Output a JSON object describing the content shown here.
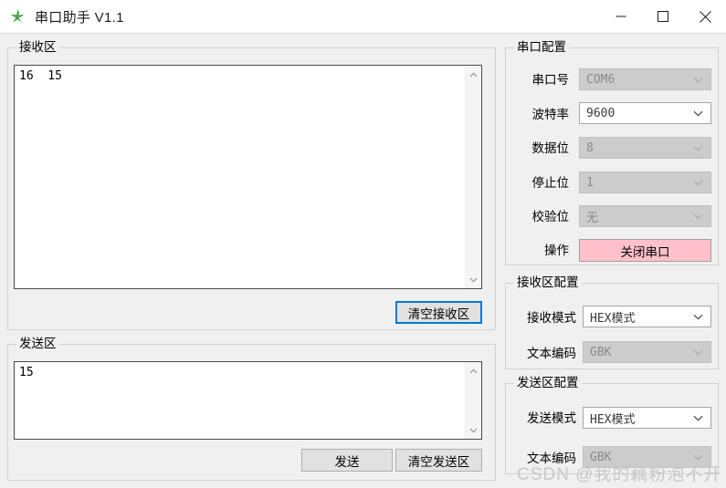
{
  "window": {
    "title": "串口助手 V1.1",
    "icon": "app-star-icon",
    "minimize_label": "—",
    "maximize_label": "□",
    "close_label": "✕"
  },
  "receive_area": {
    "legend": "接收区",
    "content": "16  15",
    "clear_button": "清空接收区"
  },
  "send_area": {
    "legend": "发送区",
    "content": "15",
    "send_button": "发送",
    "clear_button": "清空发送区"
  },
  "serial_config": {
    "legend": "串口配置",
    "rows": [
      {
        "label": "串口号",
        "value": "COM6",
        "enabled": false
      },
      {
        "label": "波特率",
        "value": "9600",
        "enabled": true
      },
      {
        "label": "数据位",
        "value": "8",
        "enabled": false
      },
      {
        "label": "停止位",
        "value": "1",
        "enabled": false
      },
      {
        "label": "校验位",
        "value": "无",
        "enabled": false
      }
    ],
    "action_label": "操作",
    "action_button": "关闭串口",
    "action_button_color": "#ffc0cb"
  },
  "receive_config": {
    "legend": "接收区配置",
    "rows": [
      {
        "label": "接收模式",
        "value": "HEX模式",
        "enabled": true
      },
      {
        "label": "文本编码",
        "value": "GBK",
        "enabled": false
      }
    ]
  },
  "send_config": {
    "legend": "发送区配置",
    "rows": [
      {
        "label": "发送模式",
        "value": "HEX模式",
        "enabled": true
      },
      {
        "label": "文本编码",
        "value": "GBK",
        "enabled": false
      }
    ]
  },
  "watermark": {
    "text": "CSDN @我的藕粉泡不开"
  }
}
